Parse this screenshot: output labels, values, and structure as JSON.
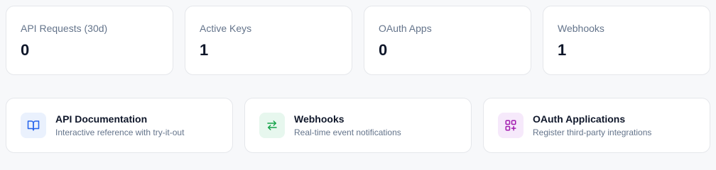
{
  "stats": [
    {
      "label": "API Requests (30d)",
      "value": "0"
    },
    {
      "label": "Active Keys",
      "value": "1"
    },
    {
      "label": "OAuth Apps",
      "value": "0"
    },
    {
      "label": "Webhooks",
      "value": "1"
    }
  ],
  "links": [
    {
      "title": "API Documentation",
      "description": "Interactive reference with try-it-out",
      "icon": "book-icon",
      "color": "#2563eb"
    },
    {
      "title": "Webhooks",
      "description": "Real-time event notifications",
      "icon": "arrows-exchange-icon",
      "color": "#16a34a"
    },
    {
      "title": "OAuth Applications",
      "description": "Register third-party integrations",
      "icon": "apps-grid-icon",
      "color": "#a21caf"
    }
  ]
}
